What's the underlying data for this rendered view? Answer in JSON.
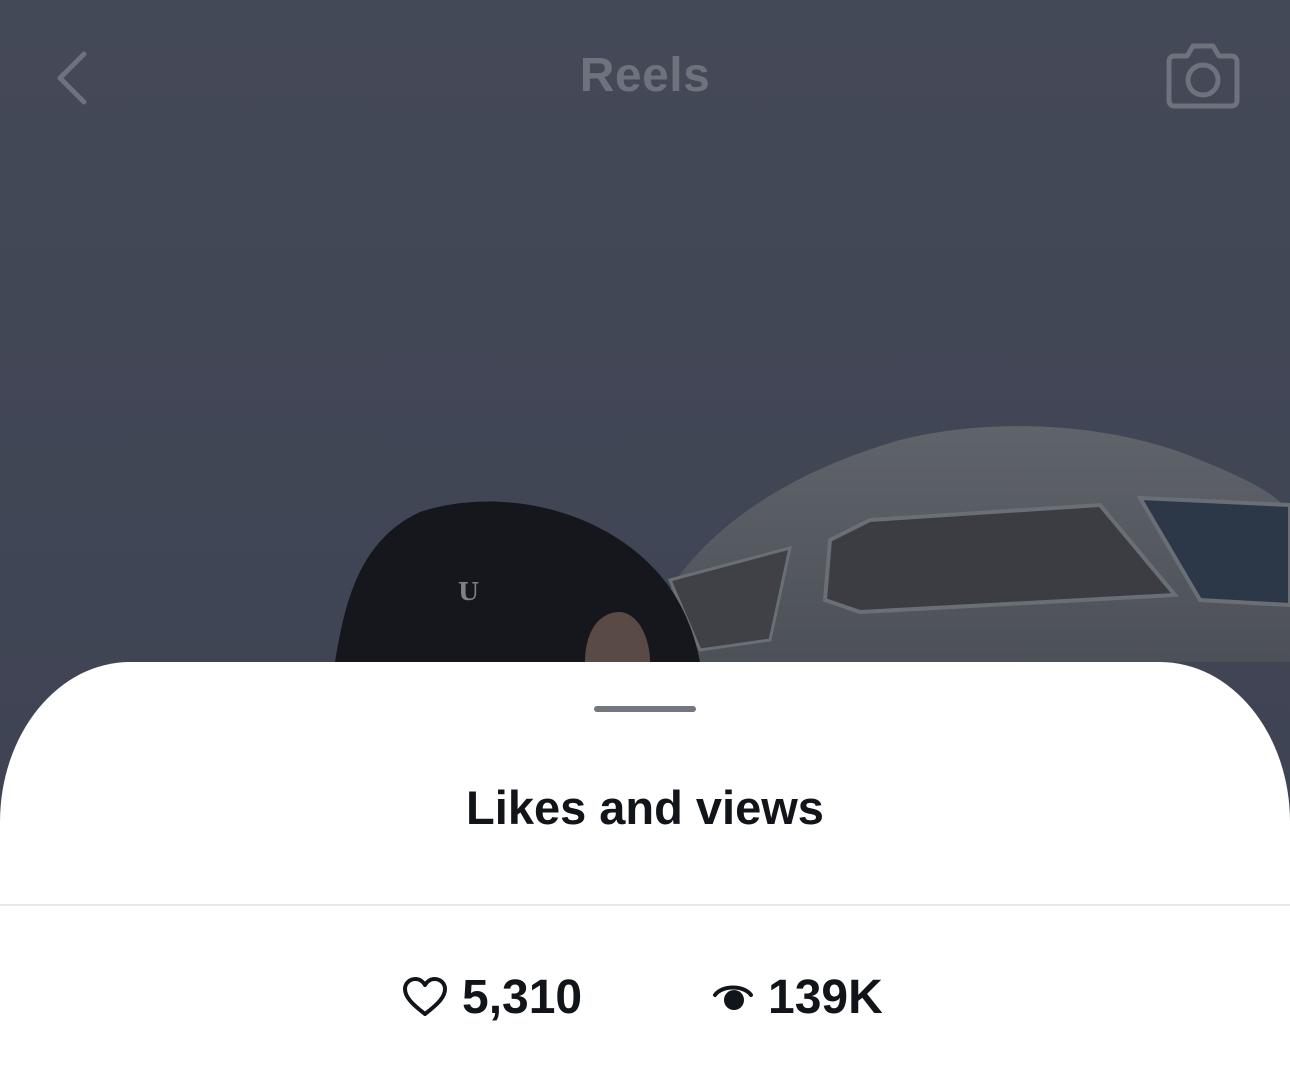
{
  "header": {
    "title": "Reels",
    "back_icon": "chevron-left-icon",
    "camera_icon": "camera-icon"
  },
  "sheet": {
    "title": "Likes and views",
    "stats": {
      "likes": {
        "icon": "heart-outline-icon",
        "value": "5,310"
      },
      "views": {
        "icon": "eye-icon",
        "value": "139K"
      }
    }
  },
  "colors": {
    "overlay_sky": "#3f4452",
    "sheet_background": "#ffffff",
    "text_primary": "#111418",
    "grabber": "#737880"
  }
}
